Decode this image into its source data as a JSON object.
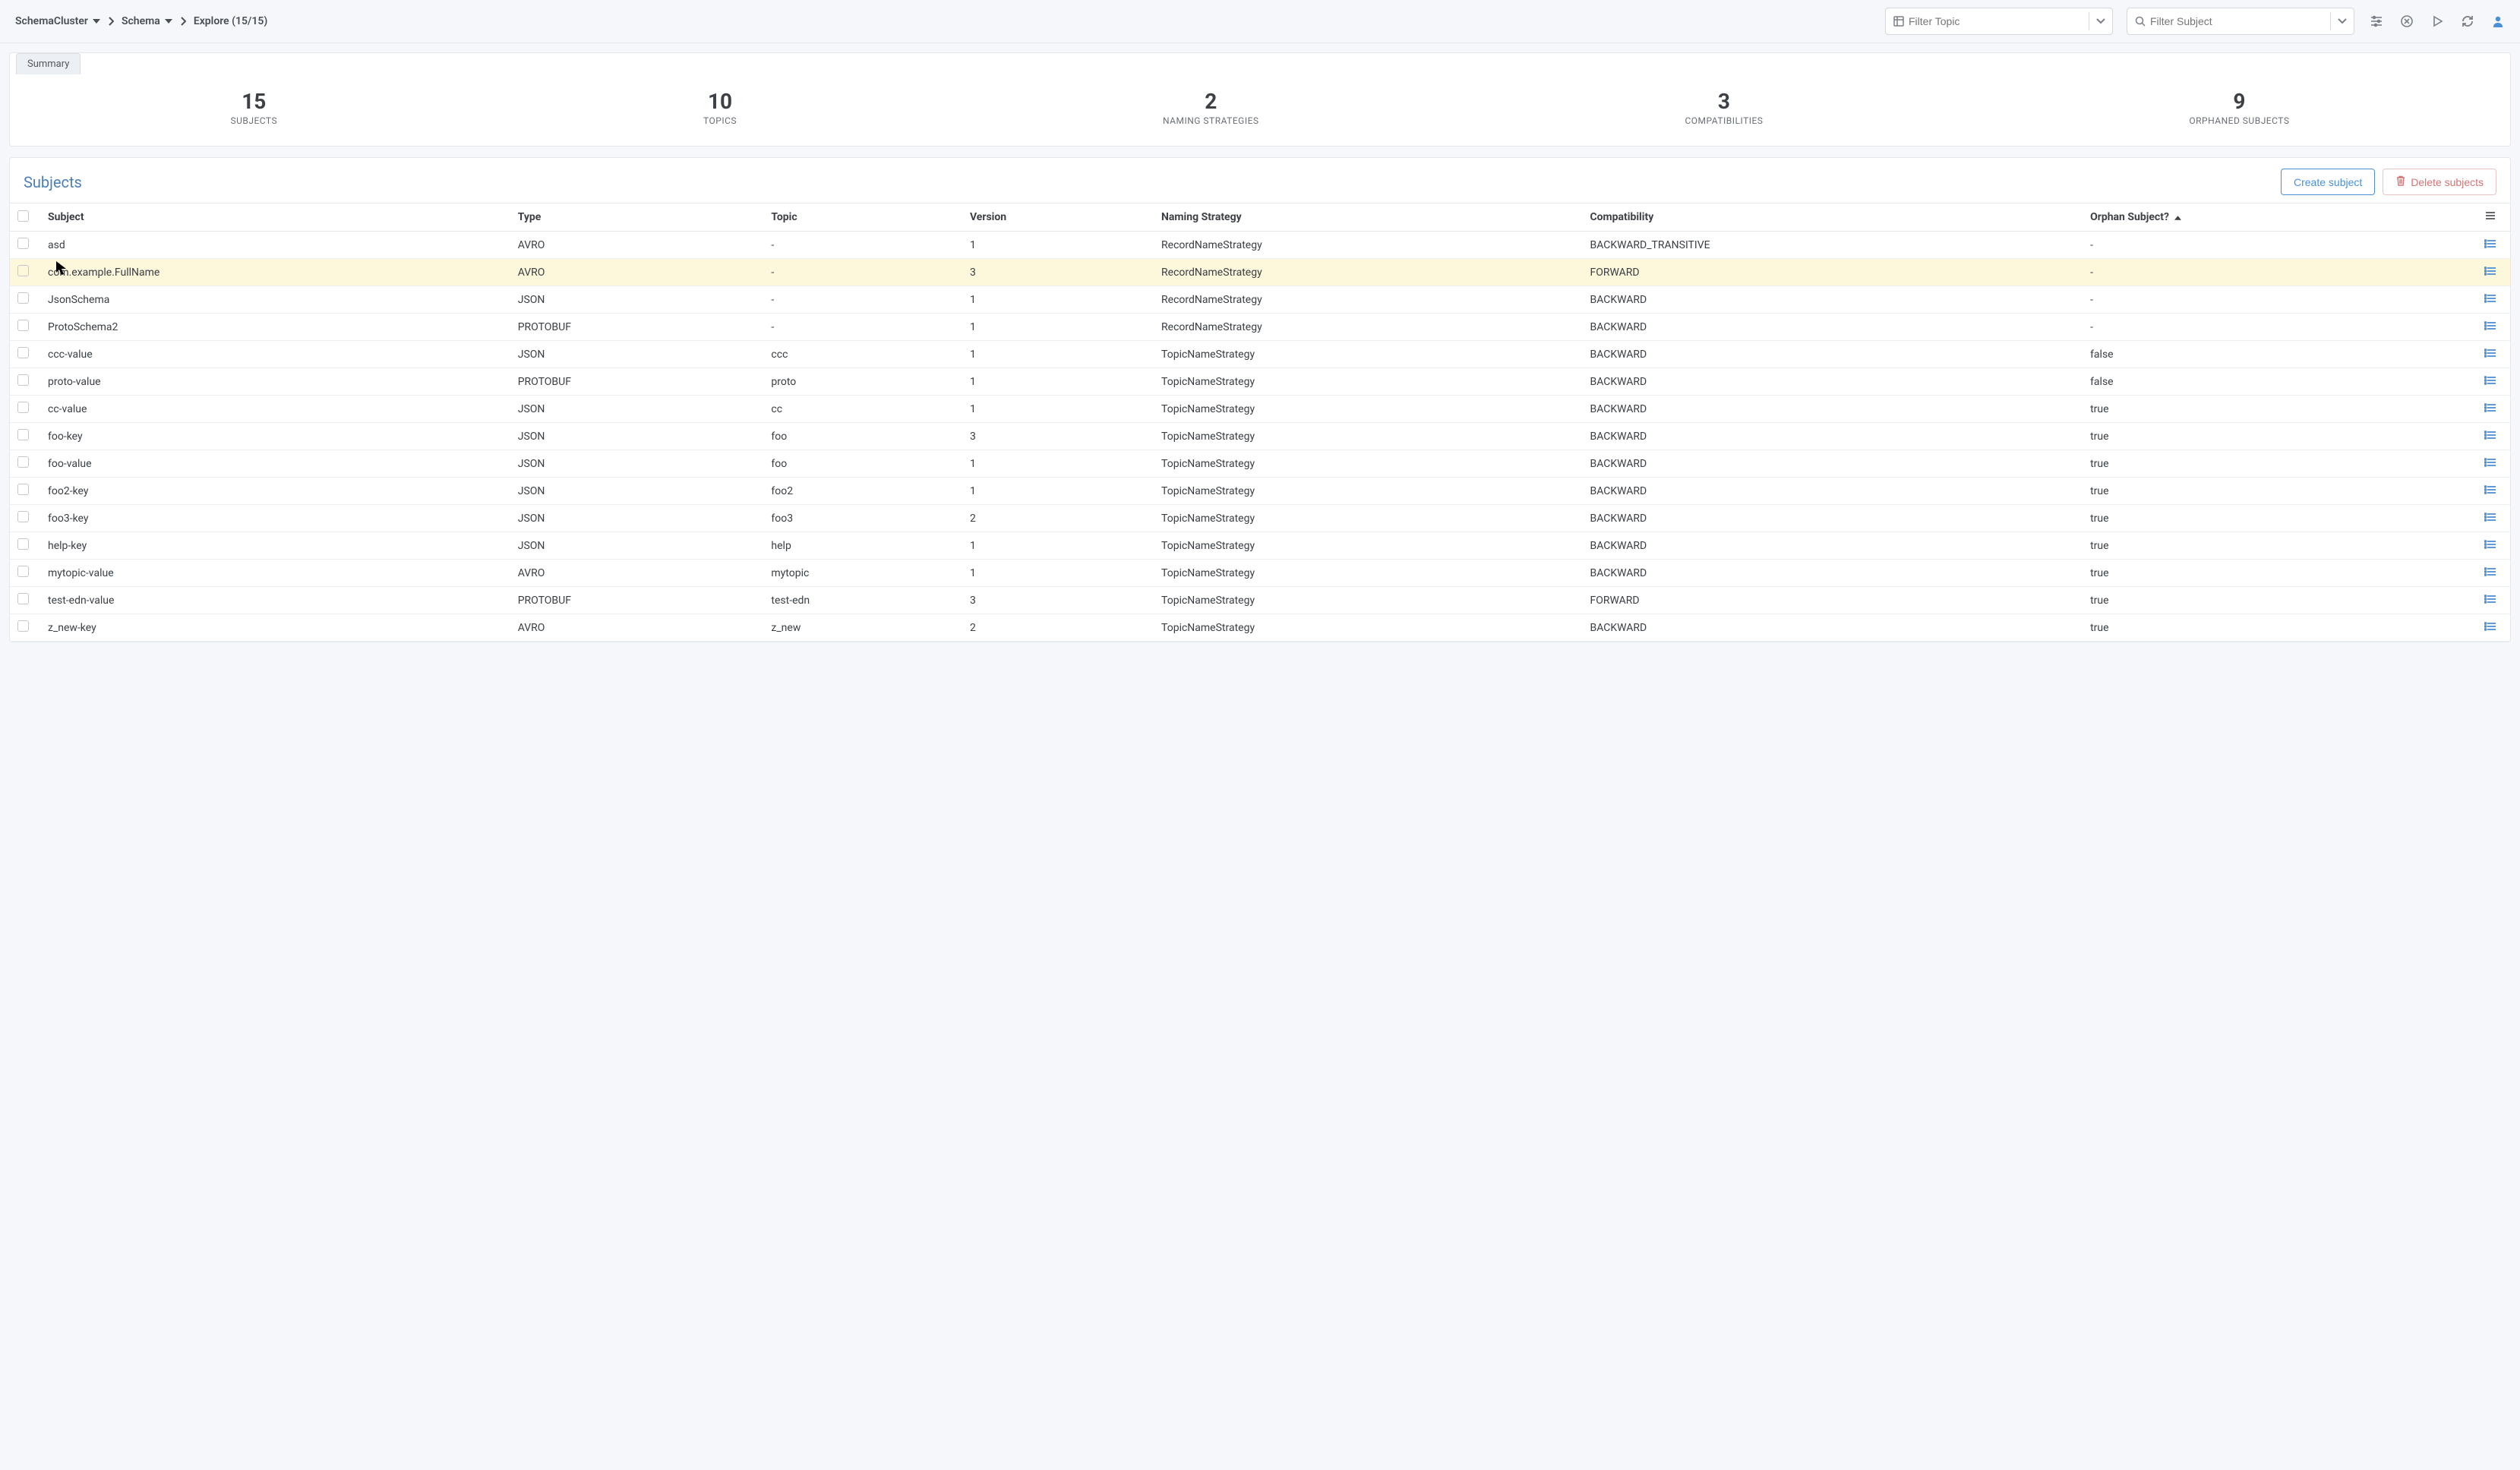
{
  "breadcrumb": {
    "cluster": "SchemaCluster",
    "schema": "Schema",
    "explore": "Explore (15/15)"
  },
  "filters": {
    "topic_placeholder": "Filter Topic",
    "subject_placeholder": "Filter Subject"
  },
  "summary": {
    "tab": "Summary",
    "stats": [
      {
        "value": "15",
        "label": "SUBJECTS"
      },
      {
        "value": "10",
        "label": "TOPICS"
      },
      {
        "value": "2",
        "label": "NAMING STRATEGIES"
      },
      {
        "value": "3",
        "label": "COMPATIBILITIES"
      },
      {
        "value": "9",
        "label": "ORPHANED SUBJECTS"
      }
    ]
  },
  "subjects": {
    "title": "Subjects",
    "create_btn": "Create subject",
    "delete_btn": "Delete subjects",
    "columns": {
      "subject": "Subject",
      "type": "Type",
      "topic": "Topic",
      "version": "Version",
      "naming": "Naming Strategy",
      "compat": "Compatibility",
      "orphan": "Orphan Subject?"
    },
    "rows": [
      {
        "subject": "asd",
        "type": "AVRO",
        "topic": "-",
        "version": "1",
        "naming": "RecordNameStrategy",
        "compat": "BACKWARD_TRANSITIVE",
        "orphan": "-",
        "hl": false
      },
      {
        "subject": "com.example.FullName",
        "type": "AVRO",
        "topic": "-",
        "version": "3",
        "naming": "RecordNameStrategy",
        "compat": "FORWARD",
        "orphan": "-",
        "hl": true
      },
      {
        "subject": "JsonSchema",
        "type": "JSON",
        "topic": "-",
        "version": "1",
        "naming": "RecordNameStrategy",
        "compat": "BACKWARD",
        "orphan": "-",
        "hl": false
      },
      {
        "subject": "ProtoSchema2",
        "type": "PROTOBUF",
        "topic": "-",
        "version": "1",
        "naming": "RecordNameStrategy",
        "compat": "BACKWARD",
        "orphan": "-",
        "hl": false
      },
      {
        "subject": "ccc-value",
        "type": "JSON",
        "topic": "ccc",
        "version": "1",
        "naming": "TopicNameStrategy",
        "compat": "BACKWARD",
        "orphan": "false",
        "hl": false
      },
      {
        "subject": "proto-value",
        "type": "PROTOBUF",
        "topic": "proto",
        "version": "1",
        "naming": "TopicNameStrategy",
        "compat": "BACKWARD",
        "orphan": "false",
        "hl": false
      },
      {
        "subject": "cc-value",
        "type": "JSON",
        "topic": "cc",
        "version": "1",
        "naming": "TopicNameStrategy",
        "compat": "BACKWARD",
        "orphan": "true",
        "hl": false
      },
      {
        "subject": "foo-key",
        "type": "JSON",
        "topic": "foo",
        "version": "3",
        "naming": "TopicNameStrategy",
        "compat": "BACKWARD",
        "orphan": "true",
        "hl": false
      },
      {
        "subject": "foo-value",
        "type": "JSON",
        "topic": "foo",
        "version": "1",
        "naming": "TopicNameStrategy",
        "compat": "BACKWARD",
        "orphan": "true",
        "hl": false
      },
      {
        "subject": "foo2-key",
        "type": "JSON",
        "topic": "foo2",
        "version": "1",
        "naming": "TopicNameStrategy",
        "compat": "BACKWARD",
        "orphan": "true",
        "hl": false
      },
      {
        "subject": "foo3-key",
        "type": "JSON",
        "topic": "foo3",
        "version": "2",
        "naming": "TopicNameStrategy",
        "compat": "BACKWARD",
        "orphan": "true",
        "hl": false
      },
      {
        "subject": "help-key",
        "type": "JSON",
        "topic": "help",
        "version": "1",
        "naming": "TopicNameStrategy",
        "compat": "BACKWARD",
        "orphan": "true",
        "hl": false
      },
      {
        "subject": "mytopic-value",
        "type": "AVRO",
        "topic": "mytopic",
        "version": "1",
        "naming": "TopicNameStrategy",
        "compat": "BACKWARD",
        "orphan": "true",
        "hl": false
      },
      {
        "subject": "test-edn-value",
        "type": "PROTOBUF",
        "topic": "test-edn",
        "version": "3",
        "naming": "TopicNameStrategy",
        "compat": "FORWARD",
        "orphan": "true",
        "hl": false
      },
      {
        "subject": "z_new-key",
        "type": "AVRO",
        "topic": "z_new",
        "version": "2",
        "naming": "TopicNameStrategy",
        "compat": "BACKWARD",
        "orphan": "true",
        "hl": false
      }
    ]
  }
}
